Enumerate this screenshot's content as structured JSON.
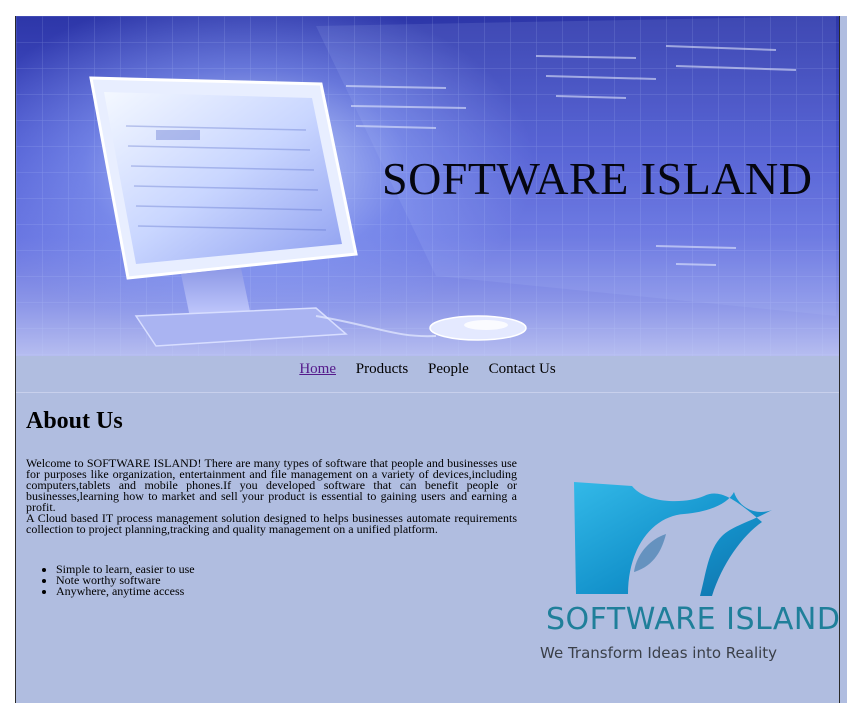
{
  "site": {
    "banner_title": "SOFTWARE ISLAND"
  },
  "nav": {
    "items": [
      {
        "label": "Home",
        "active": true
      },
      {
        "label": "Products",
        "active": false
      },
      {
        "label": "People",
        "active": false
      },
      {
        "label": "Contact Us",
        "active": false
      }
    ]
  },
  "about": {
    "heading": "About Us",
    "paragraph_1": "Welcome to SOFTWARE ISLAND! There are many types of software that people and businesses use for purposes like organization, entertainment and file management on a variety of devices,including computers,tablets and mobile phones.If you developed software that can benefit people or businesses,learning how to market and sell your product is essential to gaining users and earning a profit.",
    "paragraph_2": "A Cloud based IT process management solution designed to helps businesses automate requirements collection to project planning,tracking and quality management on a unified platform.",
    "features": [
      "Simple to learn, easier to use",
      "Note worthy software",
      "Anywhere, anytime access"
    ]
  },
  "logo": {
    "name": "SOFTWARE ISLAND",
    "tagline": "We Transform Ideas into Reality"
  },
  "colors": {
    "page_background": "#b0bde0",
    "visited_link": "#551a8b",
    "logo_teal": "#1f7f9a"
  }
}
